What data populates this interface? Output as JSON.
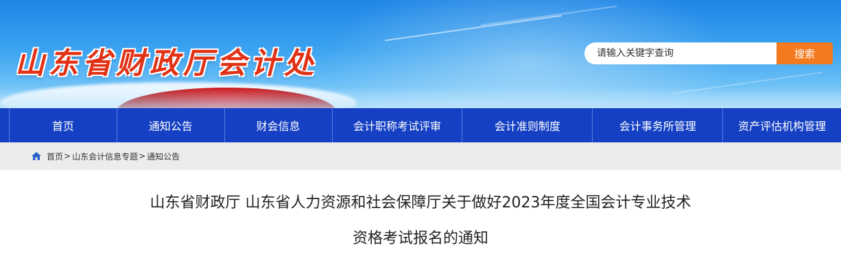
{
  "header": {
    "site_title": "山东省财政厅会计处",
    "search": {
      "placeholder": "请输入关键字查询",
      "button_label": "搜索"
    }
  },
  "nav": {
    "items": [
      {
        "label": "首页"
      },
      {
        "label": "通知公告"
      },
      {
        "label": "财会信息"
      },
      {
        "label": "会计职称考试评审"
      },
      {
        "label": "会计准则制度"
      },
      {
        "label": "会计事务所管理"
      },
      {
        "label": "资产评估机构管理"
      }
    ]
  },
  "breadcrumb": {
    "icon": "home-icon",
    "items": [
      {
        "label": "首页",
        "sep": ">"
      },
      {
        "label": "山东会计信息专题",
        "sep": ">"
      },
      {
        "label": "通知公告",
        "sep": ""
      }
    ]
  },
  "article": {
    "title_line1": "山东省财政厅 山东省人力资源和社会保障厅关于做好2023年度全国会计专业技术",
    "title_line2": "资格考试报名的通知"
  },
  "colors": {
    "nav_bg": "#1540c3",
    "search_button": "#f47a1f",
    "logo_text": "#e23216",
    "breadcrumb_bg": "#ececec"
  }
}
